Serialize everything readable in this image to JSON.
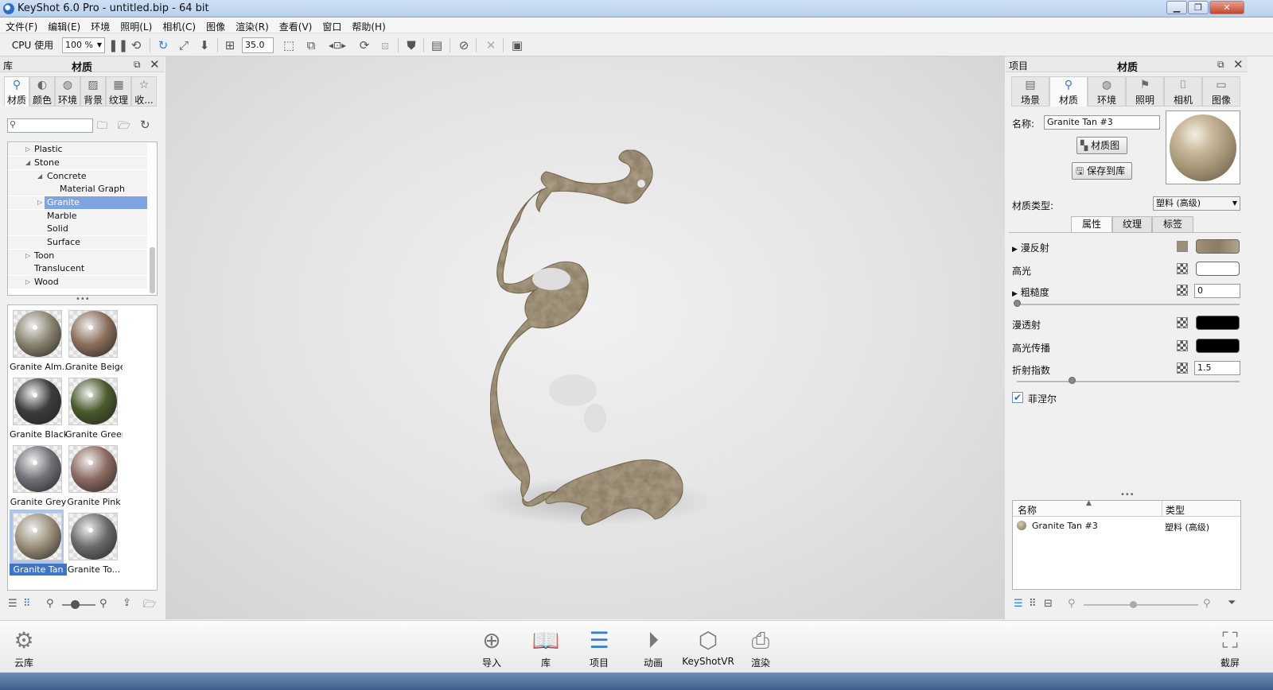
{
  "window": {
    "title": "KeyShot 6.0 Pro  -  untitled.bip  -  64 bit",
    "min": "▁",
    "max": "❐",
    "close": "✕"
  },
  "menu": [
    "文件(F)",
    "编辑(E)",
    "环境",
    "照明(L)",
    "相机(C)",
    "图像",
    "渲染(R)",
    "查看(V)",
    "窗口",
    "帮助(H)"
  ],
  "toolbar": {
    "cpu_label": "CPU 使用量",
    "cpu_value": "100 %",
    "fov_value": "35.0"
  },
  "library": {
    "header": "库",
    "title": "材质",
    "tabs": [
      {
        "label": "材质",
        "icon": "material-icon"
      },
      {
        "label": "颜色",
        "icon": "color-icon"
      },
      {
        "label": "环境",
        "icon": "environment-icon"
      },
      {
        "label": "背景",
        "icon": "background-icon"
      },
      {
        "label": "纹理",
        "icon": "texture-icon"
      },
      {
        "label": "收...",
        "icon": "favorites-icon"
      }
    ],
    "search_placeholder": "",
    "tree": [
      {
        "label": "Plastic",
        "indent": 1,
        "twisty": "▷"
      },
      {
        "label": "Stone",
        "indent": 1,
        "twisty": "◢"
      },
      {
        "label": "Concrete",
        "indent": 2,
        "twisty": "◢"
      },
      {
        "label": "Material Graph",
        "indent": 3,
        "twisty": ""
      },
      {
        "label": "Granite",
        "indent": 2,
        "twisty": "▷",
        "selected": true
      },
      {
        "label": "Marble",
        "indent": 2,
        "twisty": ""
      },
      {
        "label": "Solid",
        "indent": 2,
        "twisty": ""
      },
      {
        "label": "Surface",
        "indent": 2,
        "twisty": ""
      },
      {
        "label": "Toon",
        "indent": 1,
        "twisty": "▷"
      },
      {
        "label": "Translucent",
        "indent": 1,
        "twisty": ""
      },
      {
        "label": "Wood",
        "indent": 1,
        "twisty": "▷"
      }
    ],
    "materials": [
      {
        "label": "Granite Alm...",
        "color": "#8b8470"
      },
      {
        "label": "Granite Beige",
        "color": "#8c6f5c"
      },
      {
        "label": "Granite Black",
        "color": "#3a3c3d"
      },
      {
        "label": "Granite Green",
        "color": "#4a5a2a"
      },
      {
        "label": "Granite Grey",
        "color": "#707078"
      },
      {
        "label": "Granite Pink",
        "color": "#8d6a60"
      },
      {
        "label": "Granite Tan",
        "color": "#9b8f78",
        "selected": true
      },
      {
        "label": "Granite To...",
        "color": "#6a6a6a"
      }
    ]
  },
  "project": {
    "header": "项目",
    "title": "材质",
    "tabs": [
      {
        "label": "场景",
        "icon": "scene-icon"
      },
      {
        "label": "材质",
        "icon": "material-icon"
      },
      {
        "label": "环境",
        "icon": "environment-icon"
      },
      {
        "label": "照明",
        "icon": "lighting-icon"
      },
      {
        "label": "相机",
        "icon": "camera-icon"
      },
      {
        "label": "图像",
        "icon": "image-icon"
      }
    ],
    "name_label": "名称:",
    "name_value": "Granite Tan #3",
    "material_graph_button": "材质图",
    "save_to_library_button": "保存到库",
    "material_type_label": "材质类型:",
    "material_type_value": "塑料 (高级)",
    "subtabs": [
      "属性",
      "纹理",
      "标签"
    ],
    "properties": {
      "diffuse": "漫反射",
      "specular": "高光",
      "roughness": "粗糙度",
      "roughness_value": "0",
      "diffuse_transmission": "漫透射",
      "specular_transmission": "高光传播",
      "refractive_index": "折射指数",
      "refractive_index_value": "1.5",
      "fresnel": "菲涅尔"
    },
    "list_columns": [
      "名称",
      "类型"
    ],
    "list_rows": [
      {
        "name": "Granite Tan #3",
        "type": "塑料 (高级)"
      }
    ]
  },
  "dock": [
    {
      "label": "云库",
      "icon": "cloud-library-icon"
    },
    {
      "label": "导入",
      "icon": "import-icon"
    },
    {
      "label": "库",
      "icon": "library-icon"
    },
    {
      "label": "项目",
      "icon": "project-icon"
    },
    {
      "label": "动画",
      "icon": "animation-icon"
    },
    {
      "label": "KeyShotVR",
      "icon": "keyshotvr-icon"
    },
    {
      "label": "渲染",
      "icon": "render-icon"
    },
    {
      "label": "截屏",
      "icon": "screenshot-icon"
    }
  ],
  "colors": {
    "accent": "#2f7fd8",
    "selection": "#7da4e0",
    "granite_tan": "#9b8f78"
  }
}
